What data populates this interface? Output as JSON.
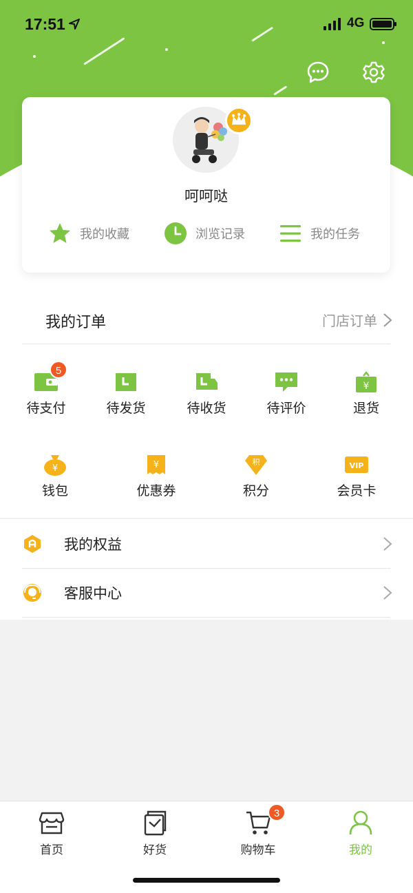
{
  "status_bar": {
    "time": "17:51",
    "network": "4G"
  },
  "profile": {
    "username": "呵呵哒"
  },
  "quick_links": [
    {
      "label": "我的收藏",
      "icon": "star-icon"
    },
    {
      "label": "浏览记录",
      "icon": "clock-icon"
    },
    {
      "label": "我的任务",
      "icon": "list-icon"
    }
  ],
  "orders": {
    "title": "我的订单",
    "store_orders_link": "门店订单",
    "statuses": [
      {
        "label": "待支付",
        "icon": "wallet-icon",
        "badge": "5"
      },
      {
        "label": "待发货",
        "icon": "box-icon"
      },
      {
        "label": "待收货",
        "icon": "truck-icon"
      },
      {
        "label": "待评价",
        "icon": "comment-icon"
      },
      {
        "label": "退货",
        "icon": "refund-icon"
      }
    ]
  },
  "assets": [
    {
      "label": "钱包",
      "icon": "money-bag-icon"
    },
    {
      "label": "优惠券",
      "icon": "coupon-icon"
    },
    {
      "label": "积分",
      "icon": "points-icon",
      "icon_text": "积"
    },
    {
      "label": "会员卡",
      "icon": "vip-card-icon",
      "icon_text": "VIP"
    }
  ],
  "menu": [
    {
      "label": "我的权益",
      "icon": "benefits-icon"
    },
    {
      "label": "客服中心",
      "icon": "customer-service-icon"
    }
  ],
  "tabbar": {
    "items": [
      {
        "label": "首页",
        "icon": "store-icon"
      },
      {
        "label": "好货",
        "icon": "goods-icon"
      },
      {
        "label": "购物车",
        "icon": "cart-icon",
        "badge": "3"
      },
      {
        "label": "我的",
        "icon": "profile-icon",
        "active": true
      }
    ]
  },
  "colors": {
    "brand_green": "#7cc442",
    "accent_yellow": "#f5b21a",
    "badge_orange": "#ef5a24"
  }
}
